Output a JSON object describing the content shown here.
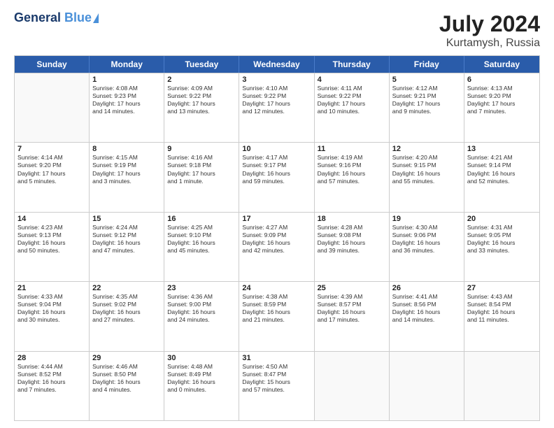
{
  "header": {
    "logo_line1": "General",
    "logo_line2": "Blue",
    "month_year": "July 2024",
    "location": "Kurtamysh, Russia"
  },
  "weekdays": [
    "Sunday",
    "Monday",
    "Tuesday",
    "Wednesday",
    "Thursday",
    "Friday",
    "Saturday"
  ],
  "rows": [
    [
      {
        "day": "",
        "lines": []
      },
      {
        "day": "1",
        "lines": [
          "Sunrise: 4:08 AM",
          "Sunset: 9:23 PM",
          "Daylight: 17 hours",
          "and 14 minutes."
        ]
      },
      {
        "day": "2",
        "lines": [
          "Sunrise: 4:09 AM",
          "Sunset: 9:22 PM",
          "Daylight: 17 hours",
          "and 13 minutes."
        ]
      },
      {
        "day": "3",
        "lines": [
          "Sunrise: 4:10 AM",
          "Sunset: 9:22 PM",
          "Daylight: 17 hours",
          "and 12 minutes."
        ]
      },
      {
        "day": "4",
        "lines": [
          "Sunrise: 4:11 AM",
          "Sunset: 9:22 PM",
          "Daylight: 17 hours",
          "and 10 minutes."
        ]
      },
      {
        "day": "5",
        "lines": [
          "Sunrise: 4:12 AM",
          "Sunset: 9:21 PM",
          "Daylight: 17 hours",
          "and 9 minutes."
        ]
      },
      {
        "day": "6",
        "lines": [
          "Sunrise: 4:13 AM",
          "Sunset: 9:20 PM",
          "Daylight: 17 hours",
          "and 7 minutes."
        ]
      }
    ],
    [
      {
        "day": "7",
        "lines": [
          "Sunrise: 4:14 AM",
          "Sunset: 9:20 PM",
          "Daylight: 17 hours",
          "and 5 minutes."
        ]
      },
      {
        "day": "8",
        "lines": [
          "Sunrise: 4:15 AM",
          "Sunset: 9:19 PM",
          "Daylight: 17 hours",
          "and 3 minutes."
        ]
      },
      {
        "day": "9",
        "lines": [
          "Sunrise: 4:16 AM",
          "Sunset: 9:18 PM",
          "Daylight: 17 hours",
          "and 1 minute."
        ]
      },
      {
        "day": "10",
        "lines": [
          "Sunrise: 4:17 AM",
          "Sunset: 9:17 PM",
          "Daylight: 16 hours",
          "and 59 minutes."
        ]
      },
      {
        "day": "11",
        "lines": [
          "Sunrise: 4:19 AM",
          "Sunset: 9:16 PM",
          "Daylight: 16 hours",
          "and 57 minutes."
        ]
      },
      {
        "day": "12",
        "lines": [
          "Sunrise: 4:20 AM",
          "Sunset: 9:15 PM",
          "Daylight: 16 hours",
          "and 55 minutes."
        ]
      },
      {
        "day": "13",
        "lines": [
          "Sunrise: 4:21 AM",
          "Sunset: 9:14 PM",
          "Daylight: 16 hours",
          "and 52 minutes."
        ]
      }
    ],
    [
      {
        "day": "14",
        "lines": [
          "Sunrise: 4:23 AM",
          "Sunset: 9:13 PM",
          "Daylight: 16 hours",
          "and 50 minutes."
        ]
      },
      {
        "day": "15",
        "lines": [
          "Sunrise: 4:24 AM",
          "Sunset: 9:12 PM",
          "Daylight: 16 hours",
          "and 47 minutes."
        ]
      },
      {
        "day": "16",
        "lines": [
          "Sunrise: 4:25 AM",
          "Sunset: 9:10 PM",
          "Daylight: 16 hours",
          "and 45 minutes."
        ]
      },
      {
        "day": "17",
        "lines": [
          "Sunrise: 4:27 AM",
          "Sunset: 9:09 PM",
          "Daylight: 16 hours",
          "and 42 minutes."
        ]
      },
      {
        "day": "18",
        "lines": [
          "Sunrise: 4:28 AM",
          "Sunset: 9:08 PM",
          "Daylight: 16 hours",
          "and 39 minutes."
        ]
      },
      {
        "day": "19",
        "lines": [
          "Sunrise: 4:30 AM",
          "Sunset: 9:06 PM",
          "Daylight: 16 hours",
          "and 36 minutes."
        ]
      },
      {
        "day": "20",
        "lines": [
          "Sunrise: 4:31 AM",
          "Sunset: 9:05 PM",
          "Daylight: 16 hours",
          "and 33 minutes."
        ]
      }
    ],
    [
      {
        "day": "21",
        "lines": [
          "Sunrise: 4:33 AM",
          "Sunset: 9:04 PM",
          "Daylight: 16 hours",
          "and 30 minutes."
        ]
      },
      {
        "day": "22",
        "lines": [
          "Sunrise: 4:35 AM",
          "Sunset: 9:02 PM",
          "Daylight: 16 hours",
          "and 27 minutes."
        ]
      },
      {
        "day": "23",
        "lines": [
          "Sunrise: 4:36 AM",
          "Sunset: 9:00 PM",
          "Daylight: 16 hours",
          "and 24 minutes."
        ]
      },
      {
        "day": "24",
        "lines": [
          "Sunrise: 4:38 AM",
          "Sunset: 8:59 PM",
          "Daylight: 16 hours",
          "and 21 minutes."
        ]
      },
      {
        "day": "25",
        "lines": [
          "Sunrise: 4:39 AM",
          "Sunset: 8:57 PM",
          "Daylight: 16 hours",
          "and 17 minutes."
        ]
      },
      {
        "day": "26",
        "lines": [
          "Sunrise: 4:41 AM",
          "Sunset: 8:56 PM",
          "Daylight: 16 hours",
          "and 14 minutes."
        ]
      },
      {
        "day": "27",
        "lines": [
          "Sunrise: 4:43 AM",
          "Sunset: 8:54 PM",
          "Daylight: 16 hours",
          "and 11 minutes."
        ]
      }
    ],
    [
      {
        "day": "28",
        "lines": [
          "Sunrise: 4:44 AM",
          "Sunset: 8:52 PM",
          "Daylight: 16 hours",
          "and 7 minutes."
        ]
      },
      {
        "day": "29",
        "lines": [
          "Sunrise: 4:46 AM",
          "Sunset: 8:50 PM",
          "Daylight: 16 hours",
          "and 4 minutes."
        ]
      },
      {
        "day": "30",
        "lines": [
          "Sunrise: 4:48 AM",
          "Sunset: 8:49 PM",
          "Daylight: 16 hours",
          "and 0 minutes."
        ]
      },
      {
        "day": "31",
        "lines": [
          "Sunrise: 4:50 AM",
          "Sunset: 8:47 PM",
          "Daylight: 15 hours",
          "and 57 minutes."
        ]
      },
      {
        "day": "",
        "lines": []
      },
      {
        "day": "",
        "lines": []
      },
      {
        "day": "",
        "lines": []
      }
    ]
  ]
}
